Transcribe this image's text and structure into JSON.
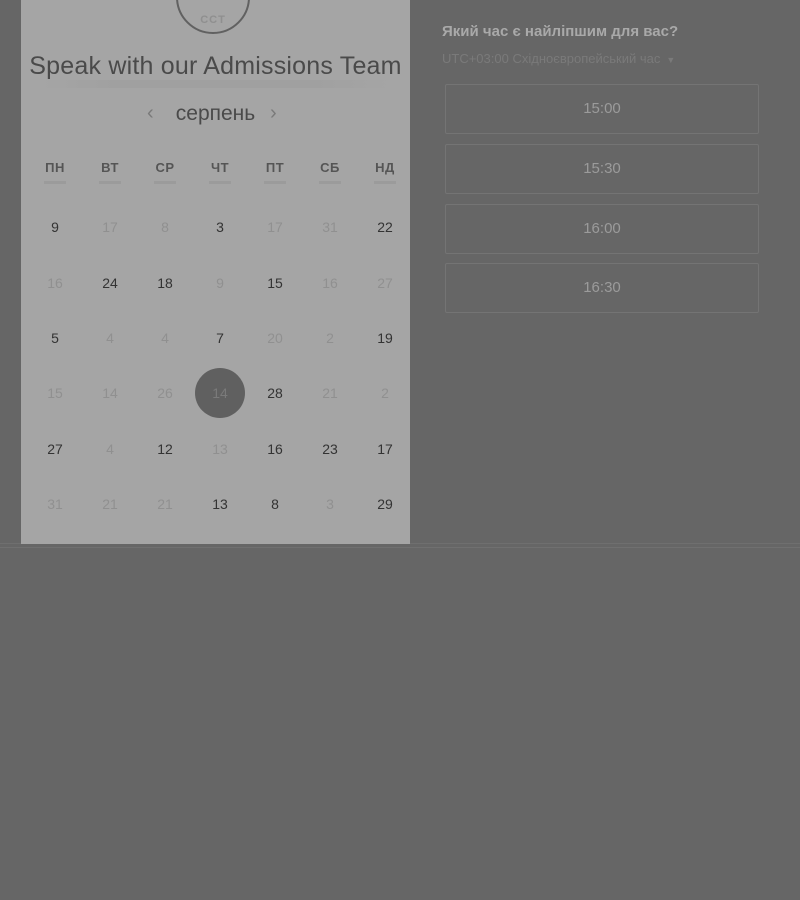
{
  "left": {
    "logo_text": "CCT",
    "title": "Speak with our Admissions Team",
    "month": "серпень",
    "prev_icon": "chevron-left-icon",
    "next_icon": "chevron-right-icon",
    "weekdays": [
      "ПН",
      "ВТ",
      "СР",
      "ЧТ",
      "ПТ",
      "СБ",
      "НД"
    ],
    "days": [
      [
        "9",
        "17",
        "8",
        "3",
        "17",
        "31",
        "22"
      ],
      [
        "16",
        "24",
        "18",
        "9",
        "15",
        "16",
        "27"
      ],
      [
        "5",
        "4",
        "4",
        "7",
        "20",
        "2",
        "19"
      ],
      [
        "15",
        "14",
        "26",
        "14",
        "28",
        "21",
        "2"
      ],
      [
        "27",
        "4",
        "12",
        "13",
        "16",
        "23",
        "17"
      ],
      [
        "31",
        "21",
        "21",
        "13",
        "8",
        "3",
        "29"
      ]
    ],
    "selected_day": "14"
  },
  "right": {
    "title": "Який час є найліпшим для вас?",
    "timezone": "UTC+03:00 Східноєвропейський час",
    "timezone_icon": "caret-down-icon",
    "slots": [
      "15:00",
      "15:30",
      "16:00",
      "16:30"
    ]
  },
  "colors": {
    "overlay": "#666666",
    "panel": "#a5a5a5",
    "selected": "#606060"
  }
}
